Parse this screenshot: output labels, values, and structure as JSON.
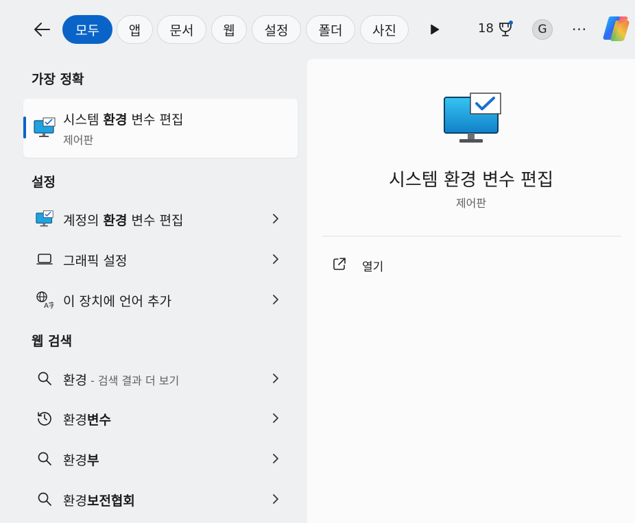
{
  "topbar": {
    "filters": [
      {
        "label": "모두",
        "active": true
      },
      {
        "label": "앱"
      },
      {
        "label": "문서"
      },
      {
        "label": "웹"
      },
      {
        "label": "설정"
      },
      {
        "label": "폴더"
      },
      {
        "label": "사진"
      }
    ],
    "points": "18",
    "avatar_initial": "G",
    "more_label": "···"
  },
  "best_match": {
    "heading": "가장 정확",
    "title_pre": "시스템 ",
    "title_bold": "환경",
    "title_post": " 변수 편집",
    "subtitle": "제어판"
  },
  "settings": {
    "heading": "설정",
    "items": [
      {
        "pre": "계정의 ",
        "bold": "환경",
        "post": " 변수 편집",
        "icon": "monitor-check-icon"
      },
      {
        "pre": "그래픽 설정",
        "bold": "",
        "post": "",
        "icon": "laptop-icon"
      },
      {
        "pre": "이 장치에 언어 추가",
        "bold": "",
        "post": "",
        "icon": "language-icon"
      }
    ]
  },
  "web": {
    "heading": "웹 검색",
    "items": [
      {
        "pre": "환경",
        "bold": "",
        "hint": " - 검색 결과 더 보기",
        "icon": "search-icon"
      },
      {
        "pre": "환경",
        "bold": "변수",
        "hint": "",
        "icon": "history-icon"
      },
      {
        "pre": "환경",
        "bold": "부",
        "hint": "",
        "icon": "search-icon"
      },
      {
        "pre": "환경",
        "bold": "보전협회",
        "hint": "",
        "icon": "search-icon"
      }
    ]
  },
  "detail": {
    "title": "시스템 환경 변수 편집",
    "subtitle": "제어판",
    "actions": [
      {
        "label": "열기",
        "icon": "open-external-icon"
      }
    ]
  },
  "colors": {
    "accent": "#0a64c8",
    "pane": "#fbfbfc",
    "background": "#eef0f2"
  }
}
